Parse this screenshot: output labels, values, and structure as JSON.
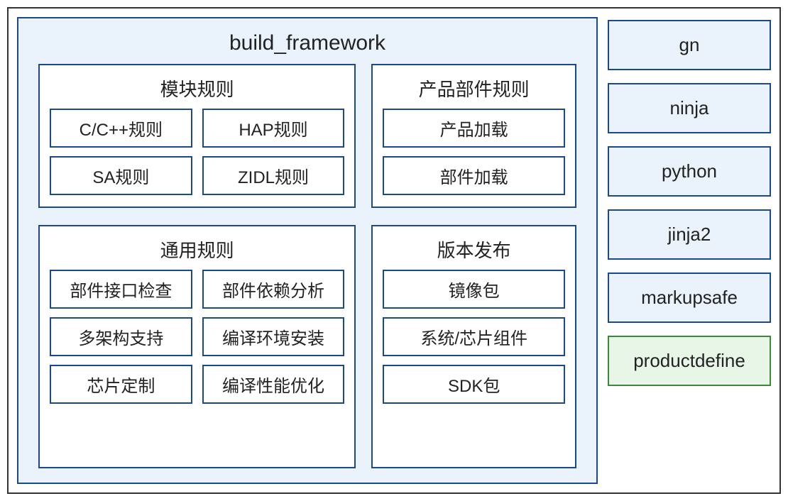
{
  "framework": {
    "title": "build_framework",
    "sections": {
      "module_rules": {
        "title": "模块规则",
        "items": [
          "C/C++规则",
          "HAP规则",
          "SA规则",
          "ZIDL规则"
        ]
      },
      "product_rules": {
        "title": "产品部件规则",
        "items": [
          "产品加载",
          "部件加载"
        ]
      },
      "general_rules": {
        "title": "通用规则",
        "items": [
          "部件接口检查",
          "部件依赖分析",
          "多架构支持",
          "编译环境安装",
          "芯片定制",
          "编译性能优化"
        ]
      },
      "version_release": {
        "title": "版本发布",
        "items": [
          "镜像包",
          "系统/芯片组件",
          "SDK包"
        ]
      }
    }
  },
  "sidebar": {
    "items": [
      {
        "label": "gn",
        "variant": "blue"
      },
      {
        "label": "ninja",
        "variant": "blue"
      },
      {
        "label": "python",
        "variant": "blue"
      },
      {
        "label": "jinja2",
        "variant": "blue"
      },
      {
        "label": "markupsafe",
        "variant": "blue"
      },
      {
        "label": "productdefine",
        "variant": "green"
      }
    ]
  }
}
